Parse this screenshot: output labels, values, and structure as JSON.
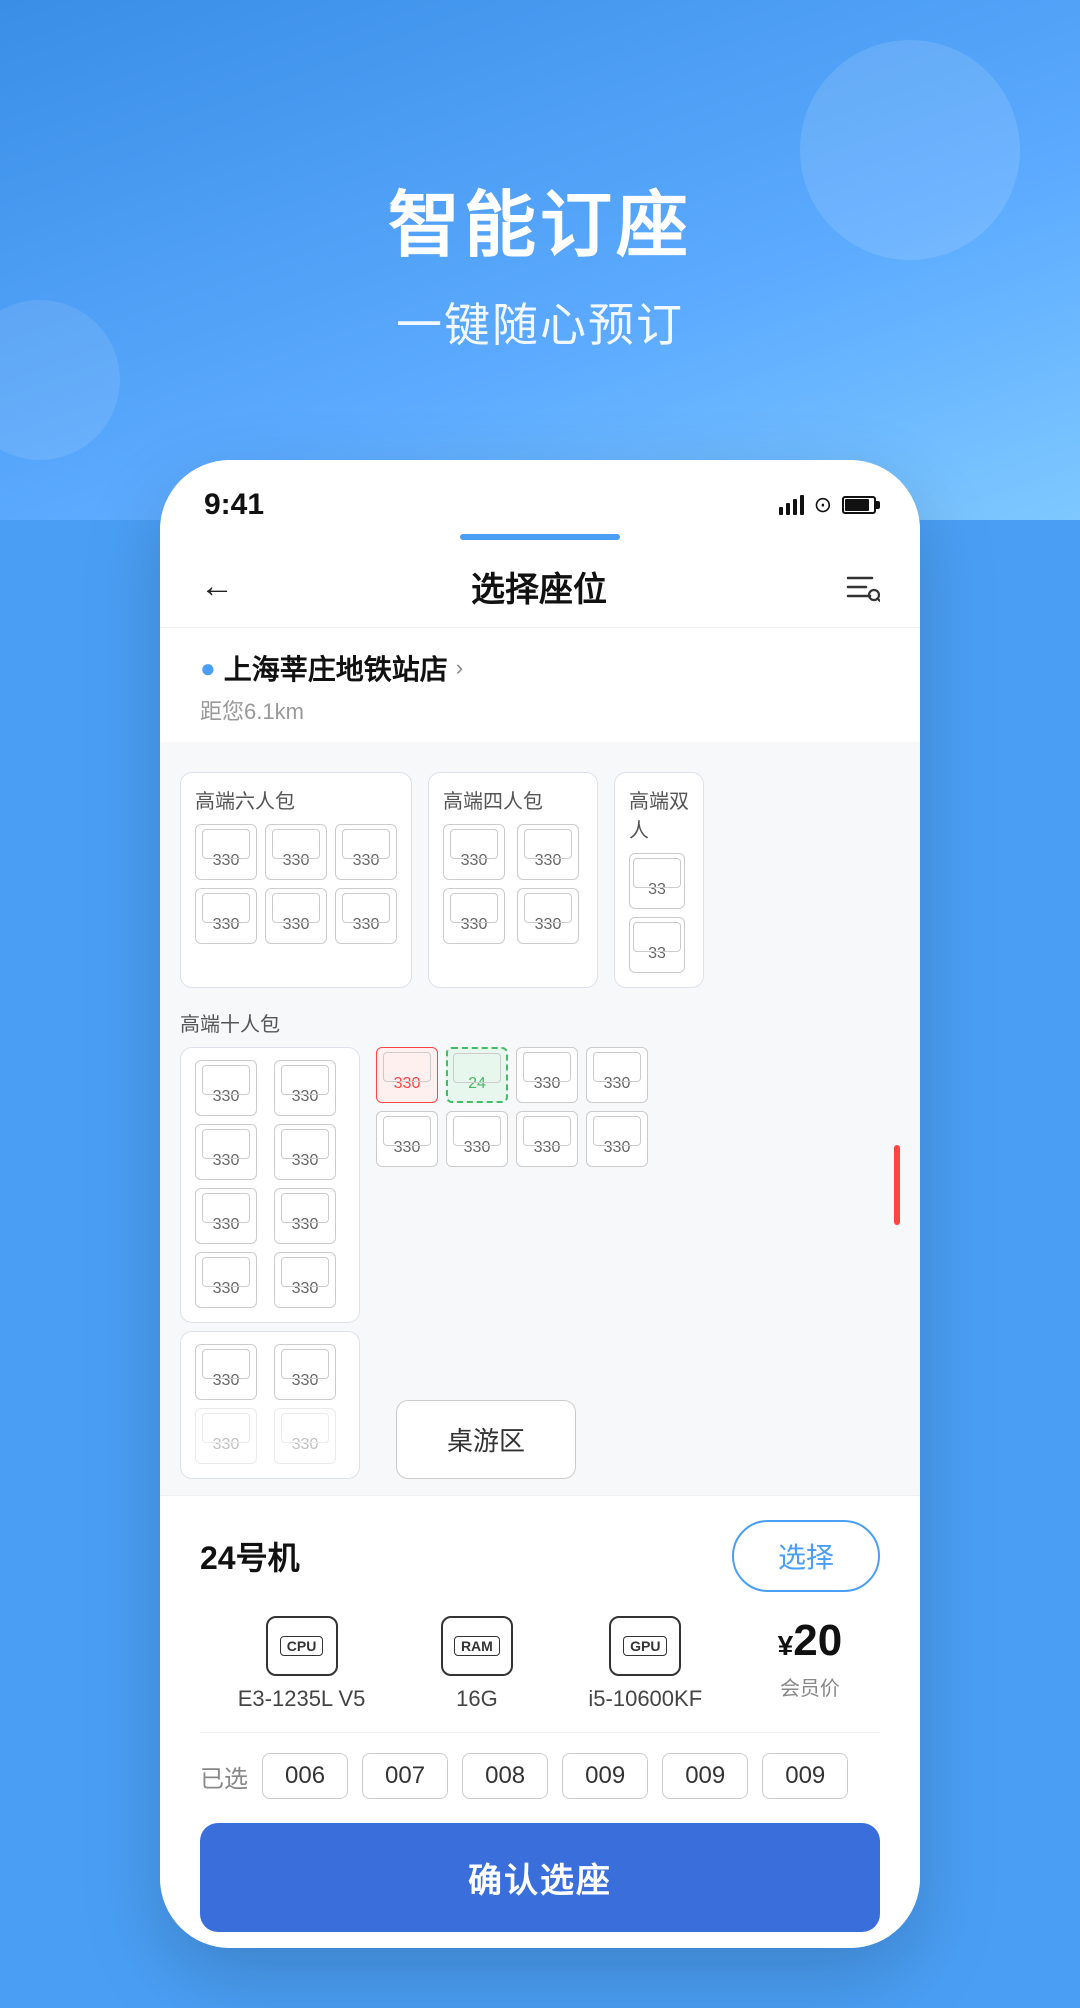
{
  "hero": {
    "title": "智能订座",
    "subtitle": "一键随心预订"
  },
  "statusBar": {
    "time": "9:41"
  },
  "navBar": {
    "title": "选择座位"
  },
  "location": {
    "name": "上海莘庄地铁站店",
    "distance": "距您6.1km"
  },
  "sections": {
    "section1_label": "高端六人包",
    "section2_label": "高端四人包",
    "section3_label": "高端双人",
    "section4_label": "高端十人包"
  },
  "selectedMachine": {
    "name": "24号机",
    "selectBtn": "选择"
  },
  "specs": {
    "cpu_label": "CPU",
    "cpu_value": "E3-1235L V5",
    "ram_label": "RAM",
    "ram_value": "16G",
    "gpu_label": "GPU",
    "gpu_value": "i5-10600KF",
    "price": "¥20",
    "price_desc": "会员价"
  },
  "selectedSeats": {
    "label": "已选",
    "seats": [
      "006",
      "007",
      "008",
      "009",
      "009",
      "009"
    ]
  },
  "confirmBtn": "确认选座",
  "tableGame": "桌游区",
  "seats6": [
    {
      "num": "330"
    },
    {
      "num": "330"
    },
    {
      "num": "330"
    },
    {
      "num": "330"
    },
    {
      "num": "330"
    },
    {
      "num": "330"
    }
  ],
  "seats4": [
    {
      "num": "330"
    },
    {
      "num": "330"
    },
    {
      "num": "330"
    },
    {
      "num": "330"
    }
  ],
  "seats10_left": [
    {
      "num": "330"
    },
    {
      "num": "330"
    },
    {
      "num": "330"
    },
    {
      "num": "330"
    },
    {
      "num": "330"
    },
    {
      "num": "330"
    },
    {
      "num": "330"
    },
    {
      "num": "330"
    }
  ],
  "seats10_right": [
    {
      "num": "330",
      "state": "occupied"
    },
    {
      "num": "24",
      "state": "selected"
    },
    {
      "num": "330"
    },
    {
      "num": "330"
    },
    {
      "num": "330"
    },
    {
      "num": "330"
    },
    {
      "num": "330"
    },
    {
      "num": "330"
    }
  ]
}
